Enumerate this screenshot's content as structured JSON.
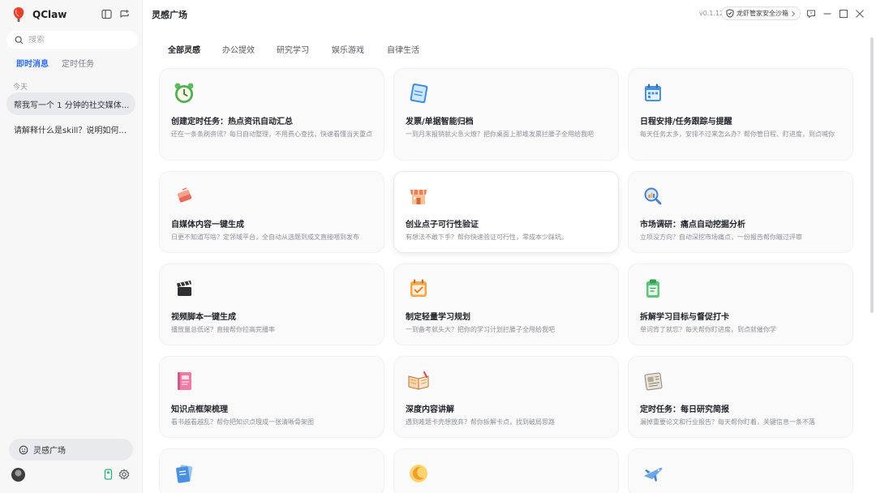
{
  "app": {
    "name": "QClaw"
  },
  "sidebar": {
    "search_placeholder": "搜索",
    "tabs": [
      {
        "label": "即时消息",
        "active": true
      },
      {
        "label": "定时任务",
        "active": false
      }
    ],
    "group_label": "今天",
    "chats": [
      {
        "label": "帮我写一个 1 分钟的社交媒体...",
        "active": true
      },
      {
        "label": "请解释什么是skill？说明如何...",
        "active": false
      }
    ],
    "inspiration_button": "灵感广场"
  },
  "header": {
    "title": "灵感广场",
    "version": "v0.1.12",
    "security_label": "龙虾管家安全沙箱"
  },
  "categories": [
    {
      "label": "全部灵感",
      "active": true
    },
    {
      "label": "办公提效",
      "active": false
    },
    {
      "label": "研究学习",
      "active": false
    },
    {
      "label": "娱乐游戏",
      "active": false
    },
    {
      "label": "自律生活",
      "active": false
    }
  ],
  "cards": [
    {
      "title": "创建定时任务：热点资讯自动汇总",
      "desc": "还在一条条刷资讯？每日自动整理，不用费心查找，快速看懂当天重点",
      "icon": "alarm-clock-icon"
    },
    {
      "title": "发票/单据智能归档",
      "desc": "一到月末报销就火急火燎？把你桌面上那堆发票拦腰子全甩给我吧",
      "icon": "notebook-icon"
    },
    {
      "title": "日程安排/任务跟踪与提醒",
      "desc": "每天任务太多，安排不过来怎么办？帮你管日程、盯进度，到点喊你",
      "icon": "calendar-icon"
    },
    {
      "title": "自媒体内容一键生成",
      "desc": "日更不知道写啥？定领域平台，全自动从选题到成文直接喂到发布",
      "icon": "eraser-icon"
    },
    {
      "title": "创业点子可行性验证",
      "desc": "有想法不敢下手？帮你快速验证可行性，零成本少踩坑。",
      "icon": "storefront-icon"
    },
    {
      "title": "市场调研：痛点自动挖掘分析",
      "desc": "立项没方向？自动深挖市场痛点，一份报告帮你瞄过评审",
      "icon": "magnifier-chart-icon"
    },
    {
      "title": "视频脚本一键生成",
      "desc": "播放量总低迷？直接帮你拉高完播率",
      "icon": "clapperboard-icon"
    },
    {
      "title": "制定轻量学习规划",
      "desc": "一到备考就头大？把你的学习计划拦腰子全甩给我吧",
      "icon": "planner-icon"
    },
    {
      "title": "拆解学习目标与督促打卡",
      "desc": "单词背了就忘？每天帮你盯进度，到点就催你学",
      "icon": "clipboard-icon"
    },
    {
      "title": "知识点框架梳理",
      "desc": "看书越看越乱？帮你把知识点理成一张清晰骨架图",
      "icon": "book-icon"
    },
    {
      "title": "深度内容讲解",
      "desc": "遇到难题卡壳想放弃？帮你拆解卡点，找到破局思路",
      "icon": "open-book-icon"
    },
    {
      "title": "定时任务：每日研究简报",
      "desc": "漏掉重要论文和行业报告？每天帮你盯着，关键信息一条不落",
      "icon": "newspaper-icon"
    },
    {
      "title": "",
      "desc": "",
      "icon": "documents-icon"
    },
    {
      "title": "",
      "desc": "",
      "icon": "moon-icon"
    },
    {
      "title": "",
      "desc": "",
      "icon": "airplane-icon"
    }
  ]
}
